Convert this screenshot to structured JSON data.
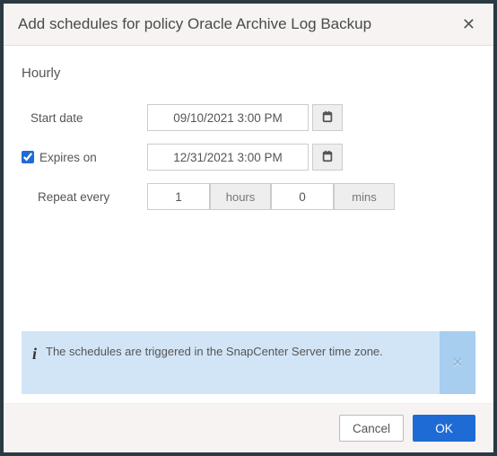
{
  "dialog": {
    "title": "Add schedules for policy Oracle Archive Log Backup"
  },
  "section": {
    "title": "Hourly"
  },
  "form": {
    "start_date": {
      "label": "Start date",
      "value": "09/10/2021 3:00 PM"
    },
    "expires_on": {
      "label": "Expires on",
      "value": "12/31/2021 3:00 PM",
      "checked": true
    },
    "repeat": {
      "label": "Repeat every",
      "hours_value": "1",
      "hours_unit": "hours",
      "mins_value": "0",
      "mins_unit": "mins"
    }
  },
  "info": {
    "text": "The schedules are triggered in the SnapCenter Server time zone."
  },
  "footer": {
    "cancel": "Cancel",
    "ok": "OK"
  }
}
